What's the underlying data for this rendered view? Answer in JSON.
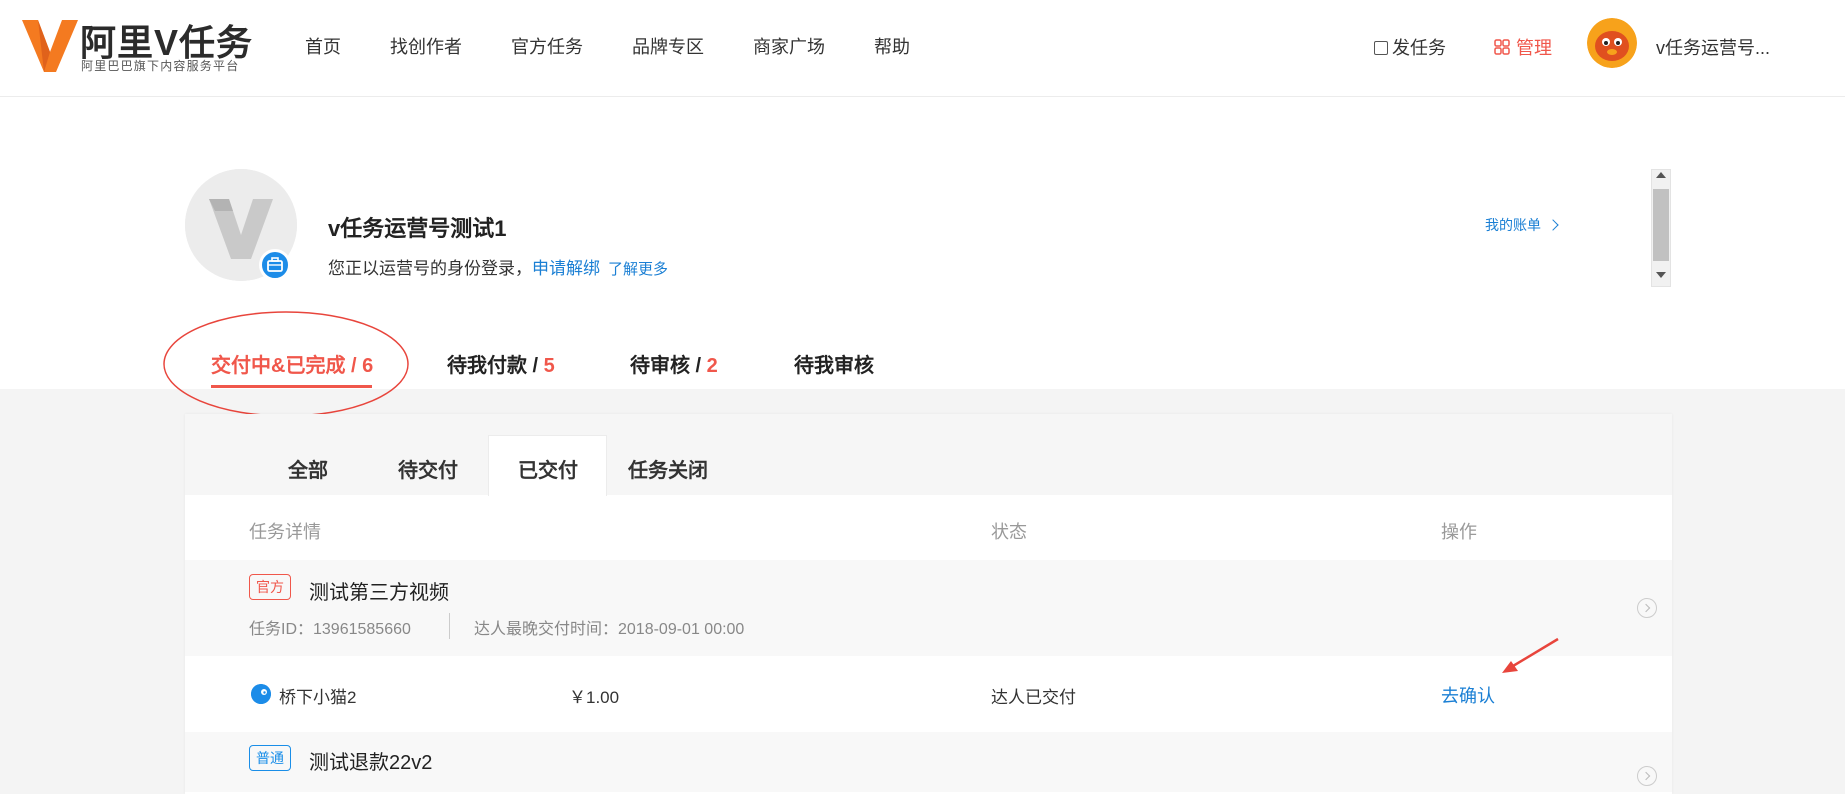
{
  "header": {
    "logo_title": "阿里V任务",
    "logo_subtitle": "阿里巴巴旗下内容服务平台",
    "nav": [
      "首页",
      "找创作者",
      "官方任务",
      "品牌专区",
      "商家广场",
      "帮助"
    ],
    "publish_label": "发任务",
    "manage_label": "管理",
    "user_name": "v任务运营号..."
  },
  "profile": {
    "account_name": "v任务运营号测试1",
    "login_text": "您正以运营号的身份登录，",
    "unbind_link": "申请解绑",
    "learn_more_link": "了解更多",
    "my_bill_link": "我的账单"
  },
  "main_tabs": [
    {
      "label": "交付中&已完成 / ",
      "count": "6"
    },
    {
      "label": "待我付款 / ",
      "count": "5"
    },
    {
      "label": "待审核 / ",
      "count": "2"
    },
    {
      "label": "待我审核",
      "count": ""
    }
  ],
  "sub_tabs": [
    "全部",
    "待交付",
    "已交付",
    "任务关闭"
  ],
  "columns": {
    "detail": "任务详情",
    "status": "状态",
    "action": "操作"
  },
  "tasks": [
    {
      "tag": "官方",
      "title": "测试第三方视频",
      "task_id": "任务ID：13961585660",
      "deadline": "达人最晚交付时间：2018-09-01 00:00",
      "talent_name": "桥下小猫2",
      "price": "￥1.00",
      "status": "达人已交付",
      "action": "去确认"
    },
    {
      "tag": "普通",
      "title": "测试退款22v2"
    }
  ],
  "colors": {
    "accent_red": "#f0574b",
    "link_blue": "#1a7fd4",
    "tag_blue": "#1a8ee8",
    "logo_orange": "#f47a20"
  }
}
